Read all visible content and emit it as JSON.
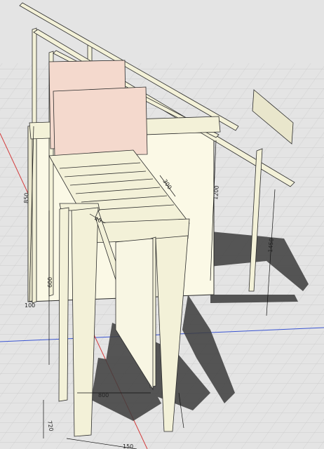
{
  "viewport": {
    "background": "#e4e4e4",
    "grid_color": "#c9c9c9",
    "axis_red": "#d23a3a",
    "axis_blue": "#3a55d2",
    "panel_color": "#fbf9e6",
    "timber_color": "#f3f1d8",
    "board_color": "#f4d9cd",
    "edge_color": "#2b2b2b",
    "shadow_color": "#3c3c3c"
  },
  "dimensions": {
    "dim_300": "300",
    "dim_850": "850",
    "dim_1450": "1450",
    "dim_800": "800",
    "dim_720": "720",
    "dim_1200": "1200",
    "dim_600": "600",
    "dim_150": "150",
    "dim_40": "40",
    "dim_100": "100"
  }
}
